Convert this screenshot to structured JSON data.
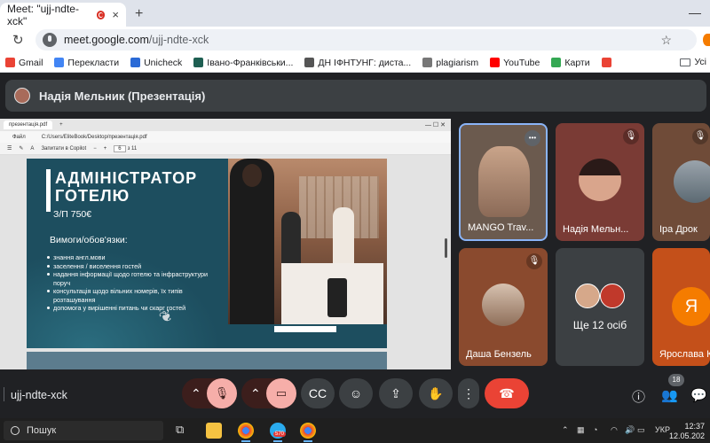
{
  "browser": {
    "tab_title": "Meet: \"ujj-ndte-xck\"",
    "tab_close": "×",
    "new_tab": "+",
    "window_controls": "—",
    "url_host": "meet.google.com",
    "url_path": "/ujj-ndte-xck",
    "bookmarks": [
      {
        "label": "Gmail",
        "color": "#ea4335"
      },
      {
        "label": "Перекласти",
        "color": "#4285f4"
      },
      {
        "label": "Unicheck",
        "color": "#2a6ad6"
      },
      {
        "label": "Івано-Франківськи...",
        "color": "#1e5f52"
      },
      {
        "label": "ДН ІФНТУНГ: диста...",
        "color": "#555555"
      },
      {
        "label": "plagiarism",
        "color": "#777777"
      },
      {
        "label": "YouTube",
        "color": "#ff0000"
      },
      {
        "label": "Карти",
        "color": "#34a853"
      },
      {
        "label": "",
        "color": "#ea4335"
      }
    ],
    "bookmark_folder": "Усі"
  },
  "meet": {
    "presenter_label": "Надія Мельник (Презентація)",
    "meeting_code": "ujj-ndte-xck",
    "people_count": "18"
  },
  "shared_screen": {
    "edge_tab": "презентація.pdf",
    "edge_file_label": "Файл",
    "edge_path": "C:/Users/EliteBook/Desktop/презентація.pdf",
    "page_current": "6",
    "page_total": "з 11",
    "copilot_label": "Запитати в Copilot",
    "slide": {
      "title": "АДМІНІСТРАТОР ГОТЕЛЮ",
      "salary": "З/П 750€",
      "requirements_heading": "Вимоги/обов'язки:",
      "requirements": [
        "знання англ.мови",
        "заселення / виселення гостей",
        "надання інформації щодо готелю та інфраструктури поруч",
        "консультація щодо вільних номерів, їх типів розташування",
        "допомога у вирішенні питань чи скарг гостей"
      ]
    }
  },
  "participants": [
    {
      "name": "MANGO Trav...",
      "bg": "#6b5a4e",
      "ring": "#8ab4f8",
      "more": "•••"
    },
    {
      "name": "Надія Мельн...",
      "bg": "#7a3b35",
      "muted": true
    },
    {
      "name": "Іра Дрок",
      "bg": "#6f4b38",
      "muted": true
    },
    {
      "name": "Даша Бензель",
      "bg": "#8a4a2e",
      "muted": true
    },
    {
      "name": "Ще 12 осіб",
      "bg": "#3c4043"
    },
    {
      "name": "Ярослава К",
      "bg": "#c4501a",
      "initial": "Я"
    }
  ],
  "taskbar": {
    "search_label": "Пошук",
    "telegram_badge": "570",
    "language": "УКР",
    "time": "12:37",
    "date": "12.05.202"
  }
}
